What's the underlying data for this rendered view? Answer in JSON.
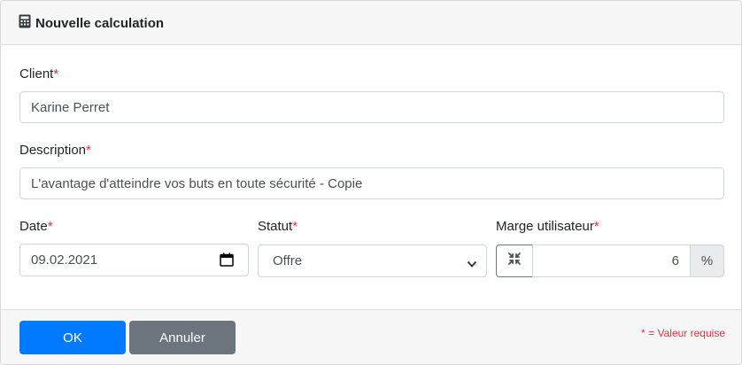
{
  "header": {
    "title": "Nouvelle calculation"
  },
  "form": {
    "client": {
      "label": "Client",
      "value": "Karine Perret"
    },
    "description": {
      "label": "Description",
      "value": "L'avantage d'atteindre vos buts en toute sécurité - Copie"
    },
    "date": {
      "label": "Date",
      "value": "09.02.2021"
    },
    "status": {
      "label": "Statut",
      "value": "Offre"
    },
    "margin": {
      "label": "Marge utilisateur",
      "value": "6",
      "unit": "%"
    },
    "required_mark": "*"
  },
  "footer": {
    "ok_label": "OK",
    "cancel_label": "Annuler",
    "required_note": "* = Valeur requise"
  },
  "colors": {
    "primary": "#007bff",
    "secondary": "#6c757d",
    "danger": "#dc3545"
  }
}
